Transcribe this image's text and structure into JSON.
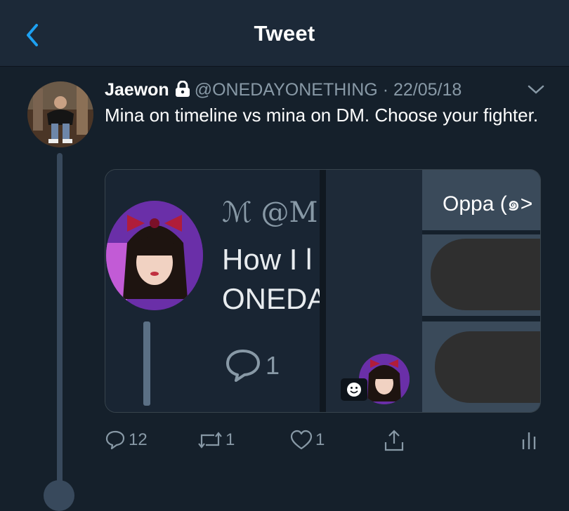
{
  "header": {
    "title": "Tweet",
    "back_icon": "chevron-left-icon"
  },
  "colors": {
    "background": "#15202b",
    "header": "#1c2938",
    "accent": "#1da1f2",
    "muted": "#8899a6"
  },
  "tweet": {
    "author_name": "Jaewon",
    "protected_icon": "lock-icon",
    "handle": "@ONEDAYONETHING",
    "separator": "·",
    "date": "22/05/18",
    "text": "Mina on timeline vs mina on DM. Choose your fighter.",
    "menu_icon": "chevron-down-icon"
  },
  "media": {
    "left_panel": {
      "name": "ℳ @M",
      "text_line1": "How I l",
      "text_line2": "ONEDA",
      "reply_count": "1"
    },
    "right_panel": {
      "header": "Oppa (๑>",
      "emoji_icon": "smiley-icon"
    }
  },
  "actions": {
    "reply_count": "12",
    "retweet_count": "1",
    "like_count": "1",
    "share_icon": "share-icon",
    "stats_icon": "stats-icon"
  }
}
